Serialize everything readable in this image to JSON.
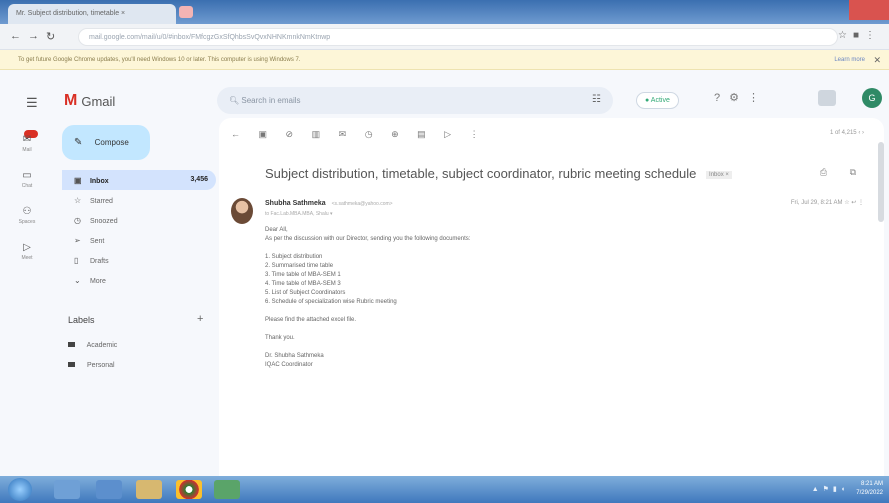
{
  "browser": {
    "tab_title": "Mr. Subject distribution, timetable ×",
    "address": "mail.google.com/mail/u/0/#inbox/FMfcgzGxSfQhbsSvQvxNHNKmnkNmKtnwp",
    "info_bar_text": "To get future Google Chrome updates, you'll need Windows 10 or later. This computer is using Windows 7.",
    "info_bar_link": "Learn more"
  },
  "gmail": {
    "app_name": "Gmail",
    "search_placeholder": "Search in emails",
    "status": "Active",
    "avatar_initial": "G",
    "compose_label": "Compose",
    "nav": [
      {
        "label": "Inbox",
        "count": "3,456",
        "icon": "inbox-icon"
      },
      {
        "label": "Starred",
        "count": "",
        "icon": "star-icon"
      },
      {
        "label": "Snoozed",
        "count": "",
        "icon": "clock-icon"
      },
      {
        "label": "Sent",
        "count": "",
        "icon": "send-icon"
      },
      {
        "label": "Drafts",
        "count": "",
        "icon": "draft-icon"
      },
      {
        "label": "More",
        "count": "",
        "icon": "chevron-down-icon"
      }
    ],
    "labels_heading": "Labels",
    "labels": [
      "Academic",
      "Personal"
    ],
    "rail": [
      {
        "label": "Mail",
        "icon": "mail-icon"
      },
      {
        "label": "Chat",
        "icon": "chat-icon"
      },
      {
        "label": "Spaces",
        "icon": "spaces-icon"
      },
      {
        "label": "Meet",
        "icon": "video-icon"
      }
    ],
    "pager": "1 of 4,215",
    "message": {
      "subject": "Subject distribution, timetable, subject coordinator, rubric meeting schedule",
      "subject_tag": "Inbox ×",
      "sender_name": "Shubha Sathmeka",
      "sender_email": "<s.sathmeka@yahoo.com>",
      "to_line": "to Fac.Lab.MBA.MBA, Shalu ▾",
      "date": "Fri, Jul 29, 8:21 AM",
      "body_greeting": "Dear All,",
      "body_intro": "As per the discussion with our Director, sending you the following documents:",
      "items": [
        "1. Subject distribution",
        "2. Summarised time table",
        "3. Time table of MBA-SEM 1",
        "4. Time table of MBA-SEM 3",
        "5. List of Subject Coordinators",
        "6. Schedule of specialization wise Rubric meeting"
      ],
      "body_request": "Please find the attached excel file.",
      "body_thanks": "Thank you.",
      "signature_name": "Dr. Shubha Sathmeka",
      "signature_role": "IQAC Coordinator"
    }
  },
  "taskbar": {
    "time": "8:21 AM",
    "date": "7/29/2022"
  },
  "colors": {
    "compose_bg": "#c2e7ff",
    "active_nav_bg": "#d3e3fd",
    "gmail_red": "#d93025",
    "taskbar_blue": "#3f78bd"
  }
}
